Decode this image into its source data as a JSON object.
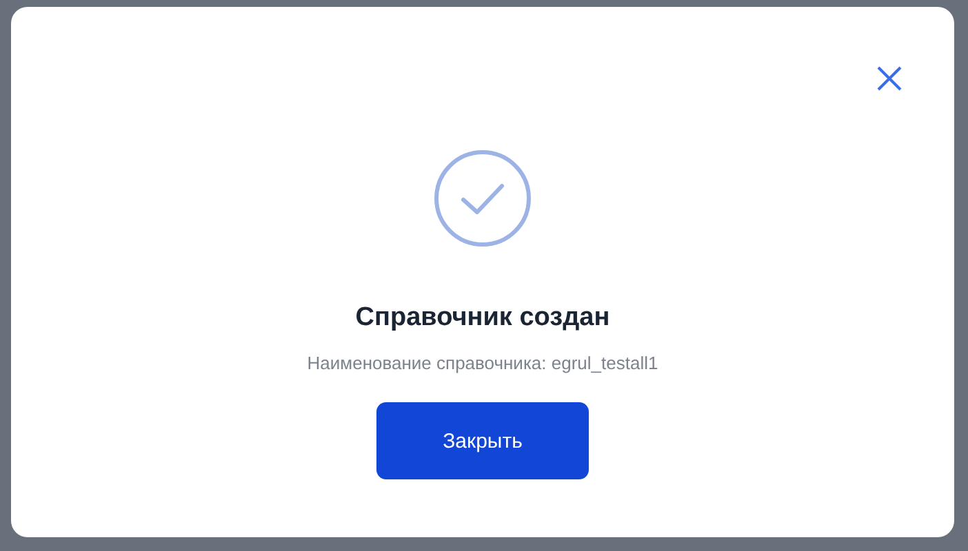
{
  "dialog": {
    "title": "Справочник создан",
    "message": "Наименование справочника: egrul_testall1",
    "buttons": [
      {
        "label": "Закрыть",
        "kind": "primary"
      }
    ]
  }
}
